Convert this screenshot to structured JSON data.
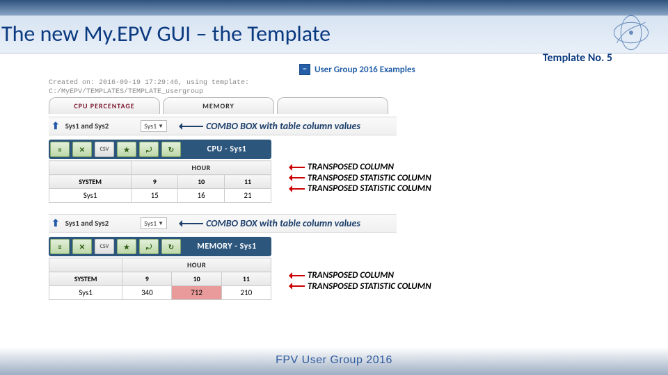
{
  "title": "The new My.EPV GUI – the Template",
  "template_no": "Template No. 5",
  "header_group": "User Group 2016 Examples",
  "created_on_line1": "Created on: 2016-09-19 17:29:46, using template:",
  "created_on_line2": "C:/MyEPV/TEMPLATES/TEMPLATE_usergroup",
  "tabs": {
    "t1": "CPU PERCENTAGE",
    "t2": "MEMORY"
  },
  "section_label": "Sys1 and Sys2",
  "combo_value": "Sys1",
  "combo_annotation": "COMBO BOX with table column values",
  "toolbar1_title": "CPU - Sys1",
  "toolbar2_title": "MEMORY - Sys1",
  "hour_label": "HOUR",
  "system_label": "SYSTEM",
  "sys_row_label": "Sys1",
  "table1": {
    "h1": "9",
    "h2": "10",
    "h3": "11",
    "v1": "15",
    "v2": "16",
    "v3": "21"
  },
  "table2": {
    "h1": "9",
    "h2": "10",
    "h3": "11",
    "v1": "340",
    "v2": "712",
    "v3": "210"
  },
  "ann_transposed_col": "TRANSPOSED COLUMN",
  "ann_transposed_stat": "TRANSPOSED STATISTIC COLUMN",
  "footer": "FPV User Group 2016",
  "icons": {
    "minus": "−",
    "up": "⬆",
    "menu": "≡",
    "chart": "✕",
    "csv": "CSV",
    "star": "★",
    "r1": "⤾",
    "r2": "↻",
    "tri": "▼"
  }
}
